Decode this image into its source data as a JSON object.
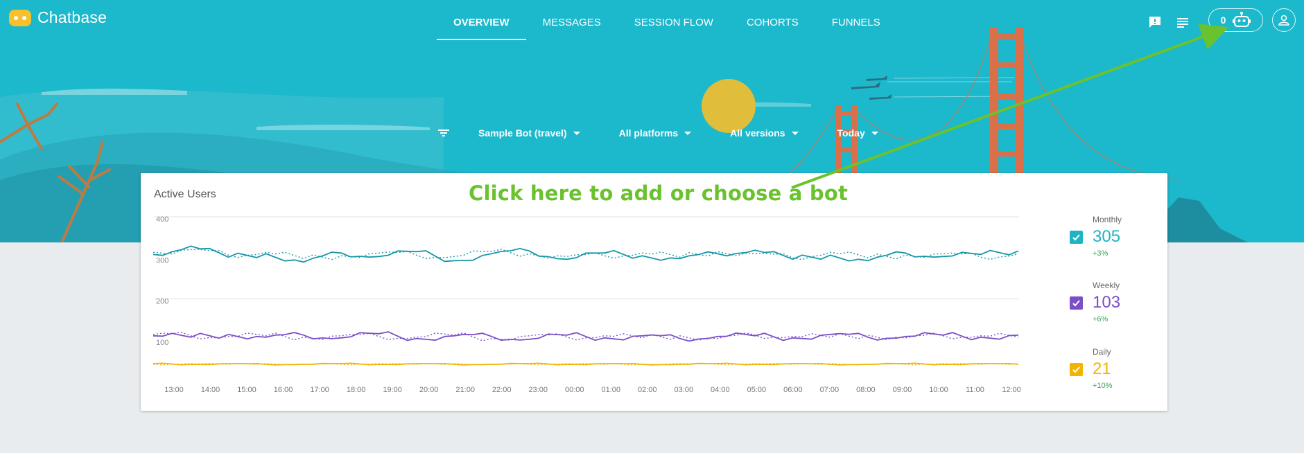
{
  "app": {
    "name": "Chatbase"
  },
  "nav": {
    "tabs": [
      {
        "label": "OVERVIEW",
        "active": true
      },
      {
        "label": "MESSAGES",
        "active": false
      },
      {
        "label": "SESSION FLOW",
        "active": false
      },
      {
        "label": "COHORTS",
        "active": false
      },
      {
        "label": "FUNNELS",
        "active": false
      }
    ]
  },
  "toolbar": {
    "feedback_icon": "feedback-icon",
    "list_icon": "list-icon",
    "bot_count": "0",
    "bot_icon": "robot-icon",
    "account_icon": "person-icon"
  },
  "filters": {
    "bot": "Sample Bot (travel)",
    "platforms": "All platforms",
    "versions": "All versions",
    "period": "Today"
  },
  "card": {
    "title": "Active Users"
  },
  "annotation": {
    "text": "Click here to add or choose a bot",
    "color": "#6ac22e"
  },
  "legend": [
    {
      "label": "Monthly",
      "value": "305",
      "delta": "+3%",
      "color": "#1fb4c4",
      "checked": true
    },
    {
      "label": "Weekly",
      "value": "103",
      "delta": "+6%",
      "color": "#7b4fc7",
      "checked": true
    },
    {
      "label": "Daily",
      "value": "21",
      "delta": "+10%",
      "color": "#f2b400",
      "checked": true
    }
  ],
  "colors": {
    "sky": "#1cb8cc",
    "background": "#e9ecee",
    "monthly": "#1597a8",
    "weekly": "#7b4fc7",
    "daily": "#f2b400",
    "delta": "#3aa45a"
  },
  "chart_data": {
    "type": "line",
    "title": "Active Users",
    "xlabel": "",
    "ylabel": "",
    "ylim": [
      0,
      400
    ],
    "y_ticks": [
      400,
      300,
      200,
      100
    ],
    "categories": [
      "13:00",
      "14:00",
      "15:00",
      "16:00",
      "17:00",
      "18:00",
      "19:00",
      "20:00",
      "21:00",
      "22:00",
      "23:00",
      "00:00",
      "01:00",
      "02:00",
      "03:00",
      "04:00",
      "05:00",
      "06:00",
      "07:00",
      "08:00",
      "09:00",
      "10:00",
      "11:00",
      "12:00"
    ],
    "series": [
      {
        "name": "Monthly",
        "style": "solid",
        "color": "#1597a8",
        "values": [
          305,
          317,
          301,
          306,
          294,
          307,
          302,
          309,
          296,
          306,
          310,
          298,
          307,
          303,
          299,
          306,
          311,
          298,
          304,
          296,
          307,
          302,
          305,
          310
        ]
      },
      {
        "name": "Monthly",
        "style": "dotted",
        "color": "#1597a8",
        "values": [
          308,
          312,
          304,
          308,
          299,
          303,
          307,
          304,
          302,
          309,
          306,
          302,
          303,
          307,
          301,
          309,
          306,
          300,
          308,
          300,
          304,
          306,
          301,
          306
        ]
      },
      {
        "name": "Weekly",
        "style": "solid",
        "color": "#7b4fc7",
        "values": [
          106,
          104,
          108,
          104,
          107,
          103,
          109,
          102,
          106,
          105,
          101,
          107,
          103,
          106,
          102,
          105,
          106,
          103,
          108,
          104,
          105,
          107,
          104,
          107
        ]
      },
      {
        "name": "Weekly",
        "style": "dotted",
        "color": "#7b4fc7",
        "values": [
          108,
          106,
          105,
          106,
          104,
          106,
          105,
          104,
          107,
          102,
          106,
          104,
          106,
          103,
          106,
          102,
          107,
          105,
          104,
          107,
          103,
          106,
          106,
          104
        ]
      },
      {
        "name": "Daily",
        "style": "solid",
        "color": "#f2b400",
        "values": [
          22,
          21,
          22,
          21,
          21,
          22,
          21,
          22,
          21,
          21,
          22,
          21,
          22,
          21,
          21,
          22,
          21,
          22,
          21,
          21,
          22,
          21,
          22,
          21
        ]
      },
      {
        "name": "Daily",
        "style": "dotted",
        "color": "#f2b400",
        "values": [
          21,
          22,
          21,
          22,
          21,
          21,
          22,
          21,
          22,
          21,
          21,
          22,
          21,
          21,
          22,
          21,
          22,
          21,
          22,
          21,
          21,
          22,
          21,
          22
        ]
      }
    ]
  }
}
